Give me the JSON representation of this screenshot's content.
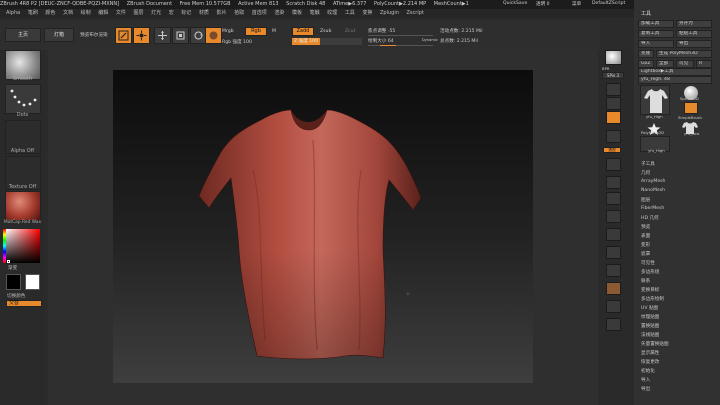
{
  "titlebar": {
    "items": [
      "ZBrush 4R8 P2 [DEUC-ZNCF-QDBE-PQZI-MXNN]",
      "ZBrush Document",
      "Free Mem 10.577GB",
      "Active Mem 813",
      "Scratch Disk 48",
      "ATime▶6.377",
      "PolyCount▶2.214 MP",
      "MeshCount▶1"
    ],
    "quicksave": "QuickSave",
    "transparency": "透明 0",
    "menus_label": "菜单",
    "script": "DefaultZScript"
  },
  "menubar": {
    "items": [
      "Alpha",
      "笔刷",
      "颜色",
      "文档",
      "绘制",
      "编辑",
      "文件",
      "图层",
      "灯光",
      "宏",
      "标记",
      "材质",
      "影片",
      "拾取",
      "首选项",
      "渲染",
      "模板",
      "笔触",
      "纹理",
      "工具",
      "变换",
      "Zplugin",
      "Zscript"
    ]
  },
  "toolbar": {
    "home": "主页",
    "lightbox": "灯箱",
    "preview": "预览布尔渲染",
    "edit": "Edit",
    "draw": "Draw",
    "move": "Move",
    "scale": "Scale",
    "rotate": "Rotate",
    "mrgb": "Mrgb",
    "rgb": "Rgb",
    "m": "M",
    "zadd": "Zadd",
    "zsub": "Zsub",
    "zcut": "Zcut",
    "rgb_intensity": "Rgb 强度 100",
    "z_intensity": "Z 强度 100",
    "focal_shift": "焦点调整 -55",
    "draw_size": "绘制大小 64",
    "dynamic": "Dynamic",
    "active_points": "活动点数: 2.215 Mil",
    "total_points": "总点数: 2.215 Mil"
  },
  "lefttray": {
    "brush": "Smooth",
    "stroke": "Dots",
    "alpha": "Alpha Off",
    "texture": "Texture Off",
    "material": "MatCap Red Wax",
    "gradient": "渐变",
    "switch_color": "切换颜色",
    "alternate": "交替"
  },
  "righttray": {
    "icons": [
      "BPR",
      "SPix 3",
      "滚动",
      "缩放",
      "Actual",
      "AAHalf",
      "透视",
      "Floor",
      "Local",
      "Gxyz",
      "框架",
      "移动",
      "缩放3D",
      "旋转",
      "Line Fill",
      "PolyF",
      "透明",
      "Ghost",
      "Solo",
      "Xpose"
    ]
  },
  "toolpanel": {
    "header": "工具",
    "buttons": [
      "加载工具",
      "另存为",
      "复制工具",
      "粘贴工具",
      "导入",
      "导出",
      "克隆",
      "生成 PolyMesh3D",
      "GoZ",
      "全部",
      "可见",
      "R"
    ],
    "lightbox_tools": "Lightbox▶工具",
    "current_tool": "yfu_High. 48",
    "thumbs": [
      "yfu_High",
      "Sphere3D",
      "SimpleBrush",
      "PolyMesh3D",
      "yfu_Low",
      "yfu_High"
    ],
    "subtools": [
      "子工具",
      "几何",
      "ArrayMesh",
      "NanoMesh",
      "图层",
      "FiberMesh",
      "HD 几何",
      "预览",
      "表面",
      "变形",
      "遮罩",
      "可见性",
      "多边形组",
      "联系",
      "变换目标",
      "多边形绘制",
      "UV 贴图",
      "纹理贴图",
      "置换贴图",
      "法线贴图",
      "矢量置换贴图",
      "显示属性",
      "恢复更改",
      "初始化",
      "导入",
      "导出"
    ]
  },
  "colors": {
    "accent": "#e8892b",
    "shirt": "#a9463b"
  }
}
